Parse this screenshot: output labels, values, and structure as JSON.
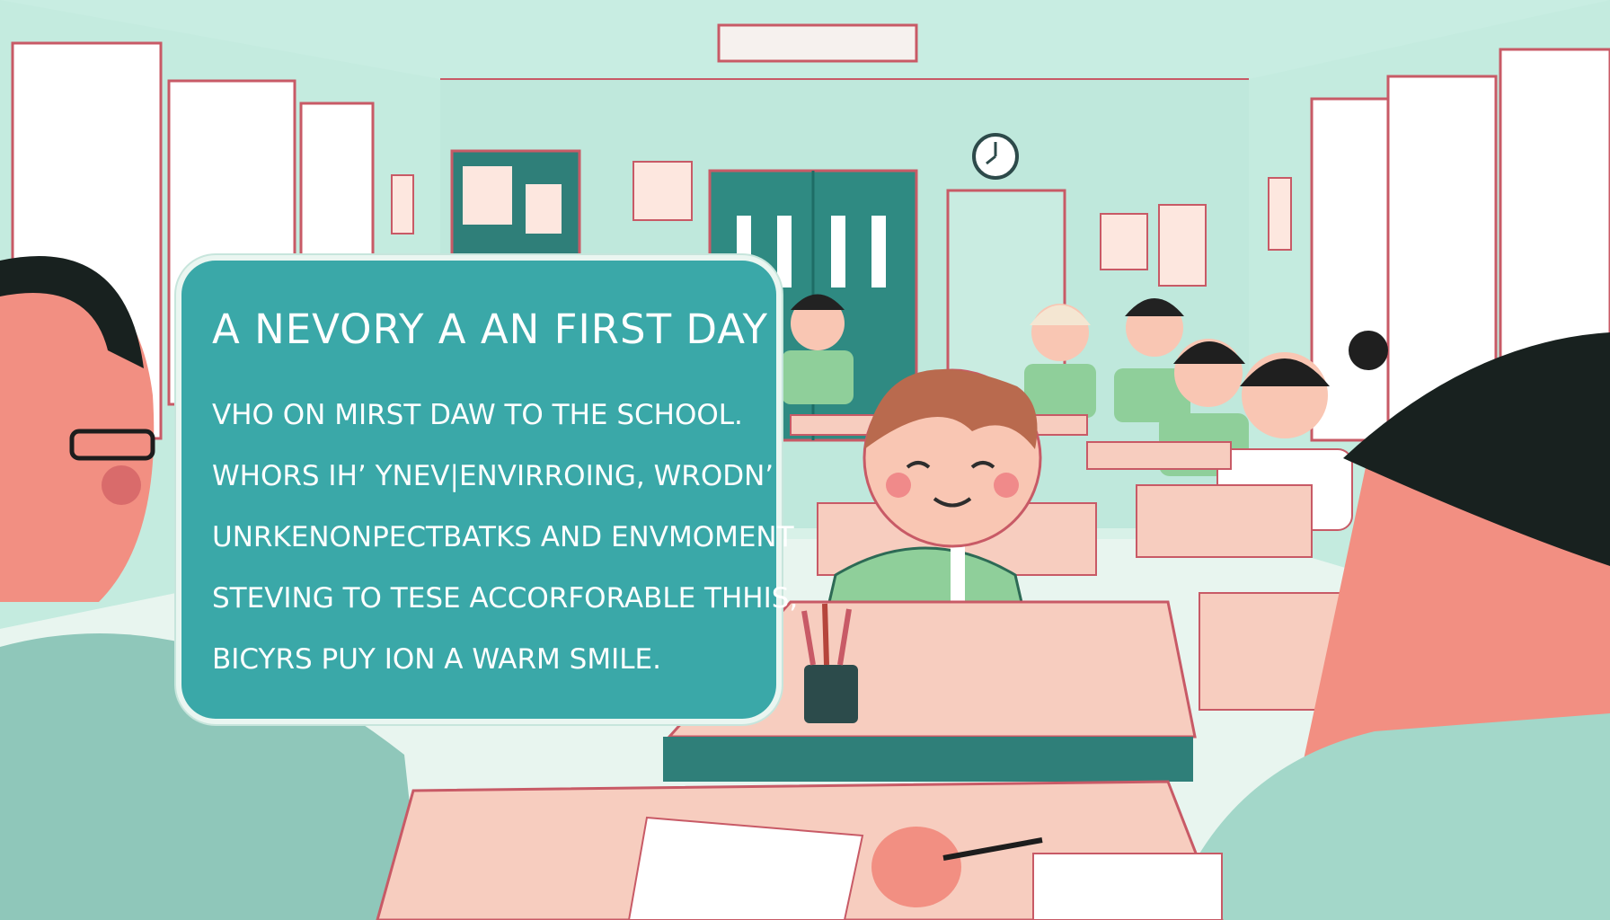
{
  "caption": {
    "title": "A  NEVORY A  AN FIRST DAY",
    "lines": [
      "VHO ON MIRST DAW TO  THE SCHOOL.",
      "WHORS IH’ YNEV|ENVIRROING, WRODN’",
      "UNRKENONPECTBATKS AND ENVMOMENT",
      "STEVING TO TESE ACCORFORABLE THHIS,",
      "BICYRS PUY ION A WARM SMILE."
    ]
  },
  "colors": {
    "wall": "#cfeee3",
    "caption_bg": "#3aa8a8",
    "desk_top": "#f7cdbf",
    "uniform": "#8fcf9a",
    "accent_red": "#c85a66"
  },
  "icons": [
    "wall-clock-icon",
    "pencil-cup-icon"
  ]
}
